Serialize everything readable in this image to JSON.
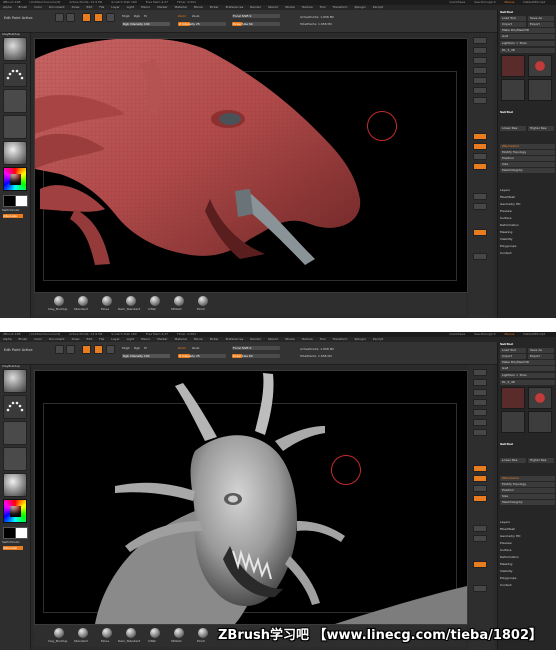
{
  "screens": [
    {
      "titlebar": {
        "items": [
          "ZBrush 4R6",
          "[Untitled Document]",
          "Active Points: 14.9 Mil",
          "Scratch Disk 160",
          "Free Mem 4.27",
          "Timer: 0.001"
        ],
        "right": [
          "QuickSave",
          "See-through 0",
          "Menus",
          "DefaultZScript"
        ]
      },
      "menu": [
        "Alpha",
        "Brush",
        "Color",
        "Document",
        "Draw",
        "Edit",
        "File",
        "Layer",
        "Light",
        "Macro",
        "Marker",
        "Material",
        "Movie",
        "Picker",
        "Preferences",
        "Render",
        "Stencil",
        "Stroke",
        "Texture",
        "Tool",
        "Transform",
        "Zplugin",
        "Zscript"
      ],
      "status": "Edit Point Active",
      "toolbar": {
        "labels": [
          "Mrgb",
          "Rgb",
          "M",
          "Zadd",
          "Zsub",
          "Focal Shift",
          "Draw Size",
          "Z Intensity",
          "ActivePoints: 1.658 Mil",
          "TotalPoints: 1.658 Mil"
        ],
        "focal_shift": "Focal Shift 0",
        "draw_size": "Draw Size 64",
        "rgb_intensity": "Rgb Intensity 100",
        "z_intensity": "Z Intensity 25"
      },
      "left": {
        "labels": [
          "ClayBuildup",
          "Standard",
          "Dots",
          "Alpha Off",
          "Texture Off",
          "MatCap Red Wax",
          "Gradient",
          "SwitchColor",
          "Alternate"
        ]
      },
      "bottom_brushes": [
        "Clay_Buildup",
        "Standard",
        "Move",
        "Dam_Standard",
        "Inflat",
        "hPolish",
        "Pinch"
      ],
      "right_panel": {
        "tool_buttons": [
          "Load Tool",
          "Save As",
          "Import",
          "Export",
          "Clone",
          "Make PolyMesh3D",
          "GoZ",
          "All",
          "Visible",
          "Lightbox > Tools"
        ],
        "current_tool": "DL_5_48",
        "subtool_items": [
          "SubTool",
          "Layers",
          "Geometry",
          "Lower Res",
          "Higher Res",
          "Del Lower",
          "Del Higher",
          "ZRemesher",
          "Modify Topology",
          "Position",
          "Size",
          "MeshIntegrity",
          "Layers",
          "FiberMesh",
          "Geometry HD",
          "Preview",
          "Surface",
          "Deformation",
          "Masking",
          "Visibility",
          "Polygroups",
          "Contact",
          "Morph Target",
          "Polypaint",
          "UV Map",
          "Texture Map",
          "Displacement Map",
          "Normal Map"
        ]
      }
    },
    {
      "titlebar": {
        "items": [
          "ZBrush 4R6",
          "[Untitled Document]",
          "Active Points: 14.9 Mil",
          "Scratch Disk 160",
          "Free Mem 4.27",
          "Timer: 0.001"
        ],
        "right": [
          "QuickSave",
          "See-through 0",
          "Menus",
          "DefaultZScript"
        ]
      },
      "menu": [
        "Alpha",
        "Brush",
        "Color",
        "Document",
        "Draw",
        "Edit",
        "File",
        "Layer",
        "Light",
        "Macro",
        "Marker",
        "Material",
        "Movie",
        "Picker",
        "Preferences",
        "Render",
        "Stencil",
        "Stroke",
        "Texture",
        "Tool",
        "Transform",
        "Zplugin",
        "Zscript"
      ],
      "status": "Edit Point Active",
      "toolbar": {
        "labels": [
          "Mrgb",
          "Rgb",
          "M",
          "Zadd",
          "Zsub",
          "Focal Shift",
          "Draw Size",
          "Z Intensity",
          "ActivePoints: 1.658 Mil",
          "TotalPoints: 1.658 Mil"
        ],
        "focal_shift": "Focal Shift 0",
        "draw_size": "Draw Size 64",
        "rgb_intensity": "Rgb Intensity 100",
        "z_intensity": "Z Intensity 25"
      },
      "left": {
        "labels": [
          "ClayBuildup",
          "Standard",
          "Dots",
          "Alpha Off",
          "Texture Off",
          "MatCap Gray",
          "Gradient",
          "SwitchColor",
          "Alternate"
        ]
      },
      "bottom_brushes": [
        "Clay_Buildup",
        "Standard",
        "Move",
        "Dam_Standard",
        "Inflat",
        "hPolish",
        "Pinch"
      ],
      "right_panel": {
        "tool_buttons": [
          "Load Tool",
          "Save As",
          "Import",
          "Export",
          "Clone",
          "Make PolyMesh3D",
          "GoZ",
          "All",
          "Visible",
          "Lightbox > Tools"
        ],
        "current_tool": "DL_5_48",
        "subtool_items": [
          "SubTool",
          "Layers",
          "Geometry",
          "Lower Res",
          "Higher Res",
          "Del Lower",
          "Del Higher",
          "ZRemesher",
          "Modify Topology",
          "Position",
          "Size",
          "MeshIntegrity",
          "Layers",
          "FiberMesh",
          "Geometry HD",
          "Preview",
          "Surface",
          "Deformation",
          "Masking",
          "Visibility",
          "Polygroups",
          "Contact",
          "Morph Target",
          "Polypaint",
          "UV Map",
          "Texture Map",
          "Displacement Map",
          "Normal Map"
        ]
      }
    }
  ],
  "watermark": "ZBrush学习吧 【www.linecg.com/tieba/1802】",
  "colors": {
    "accent": "#e87c1e",
    "model_red": "#b04a4a",
    "model_gray": "#9a9a9a",
    "cursor": "#c42b2b"
  }
}
